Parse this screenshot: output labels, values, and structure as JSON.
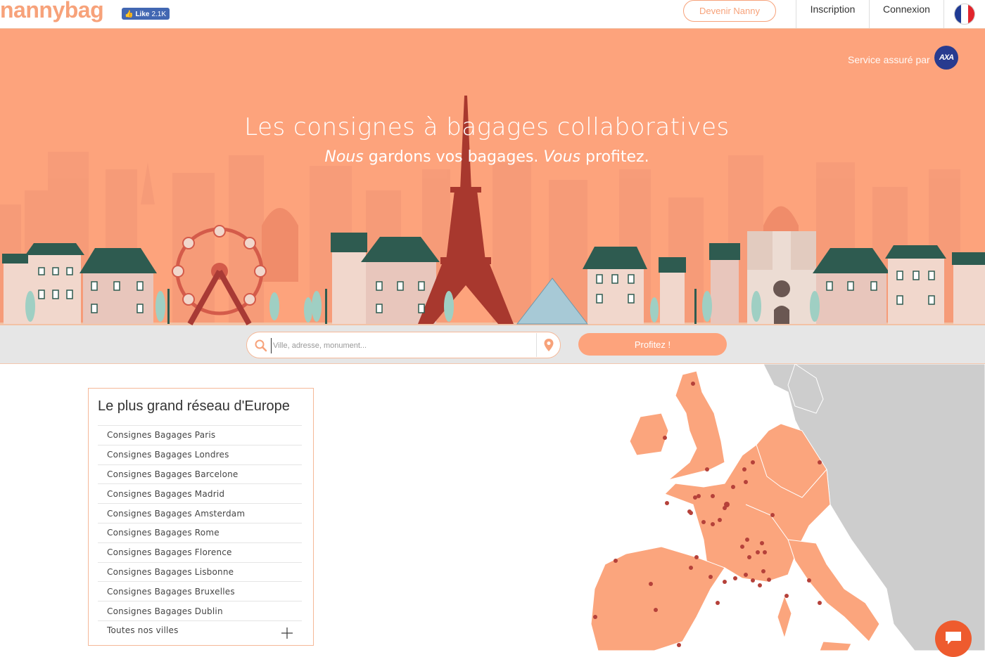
{
  "header": {
    "logo": "nannybag",
    "fb_like_label": "Like",
    "fb_like_count": "2.1K",
    "become_nanny": "Devenir Nanny",
    "signup": "Inscription",
    "login": "Connexion",
    "language_flag": "flag-fr-icon"
  },
  "hero": {
    "insurer_text": "Service assuré par",
    "insurer_logo": "AXA",
    "title": "Les consignes à bagages collaboratives",
    "subtitle_em1": "Nous",
    "subtitle_t1": " gardons vos bagages. ",
    "subtitle_em2": "Vous",
    "subtitle_t2": " profitez."
  },
  "search": {
    "placeholder": "Ville, adresse, monument...",
    "value": "",
    "submit_label": "Profitez !"
  },
  "network": {
    "title": "Le plus grand réseau d'Europe",
    "cities": [
      "Consignes Bagages Paris",
      "Consignes Bagages Londres",
      "Consignes Bagages Barcelone",
      "Consignes Bagages Madrid",
      "Consignes Bagages Amsterdam",
      "Consignes Bagages Rome",
      "Consignes Bagages Florence",
      "Consignes Bagages Lisbonne",
      "Consignes Bagages Bruxelles",
      "Consignes Bagages Dublin"
    ],
    "all_cities": "Toutes nos villes"
  },
  "colors": {
    "brand": "#fda37c",
    "brand_dark": "#f7a27a",
    "chat": "#ee5b2e",
    "map_land_active": "#fba57d",
    "map_land_other": "#cdcdcd",
    "map_dot": "#b5413a"
  }
}
